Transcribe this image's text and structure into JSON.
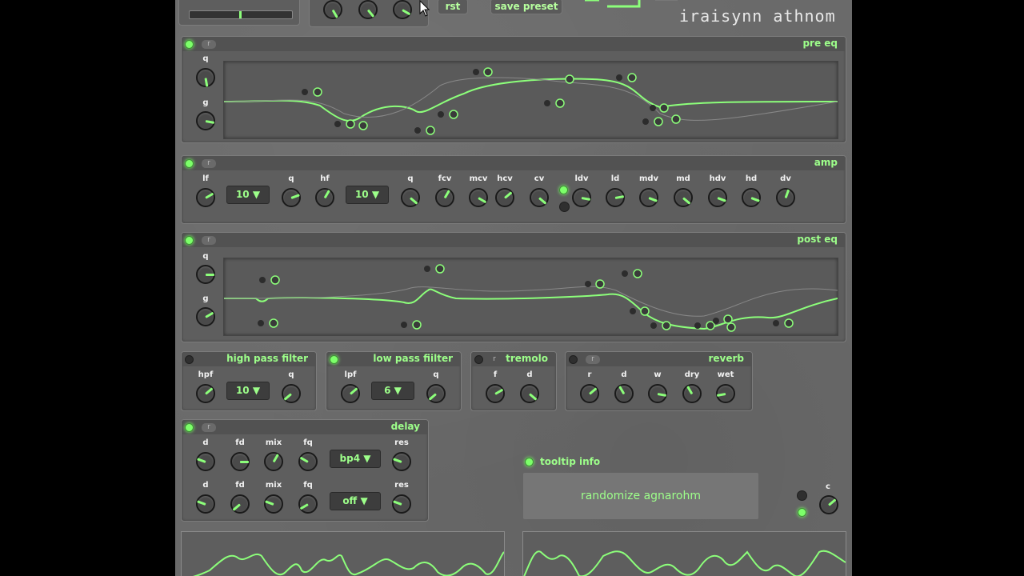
{
  "brand": {
    "logo_text": "iraisynn athnom"
  },
  "top": {
    "reset_label": "rst",
    "save_label": "save preset"
  },
  "pre_eq": {
    "title": "pre eq",
    "q_label": "q",
    "g_label": "g",
    "reset_label": "r"
  },
  "amp": {
    "title": "amp",
    "reset_label": "r",
    "labels": [
      "lf",
      "q",
      "hf",
      "q",
      "fcv",
      "mcv",
      "hcv",
      "cv",
      "ldv",
      "ld",
      "mdv",
      "md",
      "hdv",
      "hd",
      "dv"
    ],
    "lf_select": "10",
    "hf_select": "10"
  },
  "post_eq": {
    "title": "post eq",
    "q_label": "q",
    "g_label": "g",
    "reset_label": "r"
  },
  "hpf": {
    "title": "high pass filter",
    "labels": [
      "hpf",
      "q"
    ],
    "select": "10"
  },
  "lpf": {
    "title": "low pass fiilter",
    "labels": [
      "lpf",
      "q"
    ],
    "select": "6"
  },
  "tremolo": {
    "title": "tremolo",
    "reset_label": "r",
    "labels": [
      "f",
      "d"
    ]
  },
  "reverb": {
    "title": "reverb",
    "reset_label": "r",
    "labels": [
      "r",
      "d",
      "w",
      "dry",
      "wet"
    ]
  },
  "delay": {
    "title": "delay",
    "reset_label": "r",
    "row1_labels": [
      "d",
      "fd",
      "mix",
      "fq",
      "res"
    ],
    "row2_labels": [
      "d",
      "fd",
      "mix",
      "fq",
      "res"
    ],
    "row1_select": "bp4",
    "row2_select": "off"
  },
  "tooltip": {
    "label": "tooltip info",
    "text": "randomize agnarohm"
  },
  "c_knob": {
    "label": "c"
  },
  "colors": {
    "accent": "#8cff7a",
    "panel": "#5e5e5e",
    "background": "#6a6a6a"
  }
}
